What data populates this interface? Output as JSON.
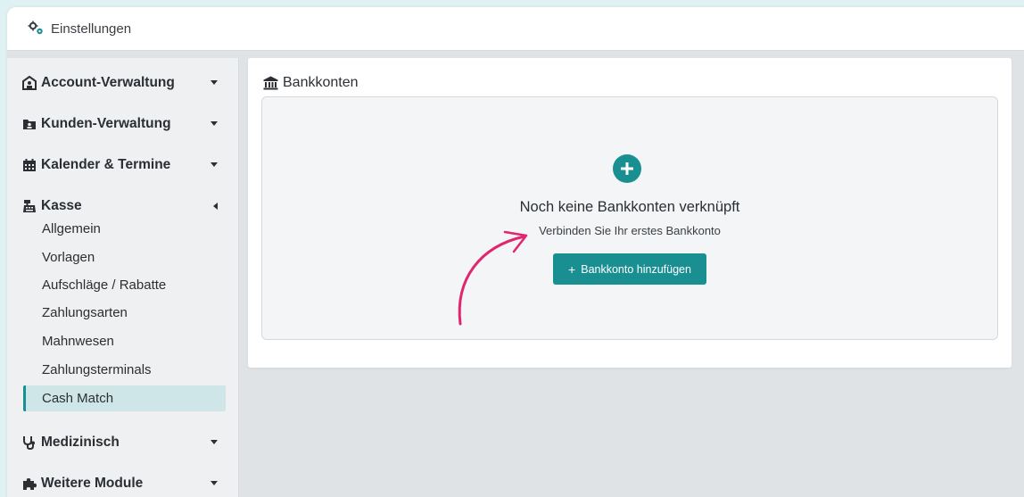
{
  "topbar": {
    "title": "Einstellungen",
    "icon": "gears-icon"
  },
  "sidebar": {
    "sections": [
      {
        "label": "Account-Verwaltung",
        "icon": "building-user-icon",
        "state": "collapsed"
      },
      {
        "label": "Kunden-Verwaltung",
        "icon": "address-card-icon",
        "state": "collapsed"
      },
      {
        "label": "Kalender & Termine",
        "icon": "calendar-icon",
        "state": "collapsed"
      },
      {
        "label": "Kasse",
        "icon": "cash-register-icon",
        "state": "expanded"
      },
      {
        "label": "Medizinisch",
        "icon": "stethoscope-icon",
        "state": "collapsed"
      },
      {
        "label": "Weitere Module",
        "icon": "puzzle-icon",
        "state": "collapsed"
      }
    ],
    "kasse_items": [
      {
        "label": "Allgemein"
      },
      {
        "label": "Vorlagen"
      },
      {
        "label": "Aufschläge / Rabatte"
      },
      {
        "label": "Zahlungsarten"
      },
      {
        "label": "Mahnwesen"
      },
      {
        "label": "Zahlungsterminals"
      },
      {
        "label": "Cash Match",
        "active": true
      }
    ]
  },
  "main": {
    "card_title": "Bankkonten",
    "card_icon": "bank-icon",
    "empty_state": {
      "title": "Noch keine Bankkonten verknüpft",
      "subtitle": "Verbinden Sie Ihr erstes Bankkonto",
      "button_label": "Bankkonto hinzufügen"
    }
  },
  "colors": {
    "accent": "#1a8f92",
    "active_bg": "#cfe6e8",
    "annotation_arrow": "#e0266e",
    "page_bg": "#dff1f3"
  }
}
